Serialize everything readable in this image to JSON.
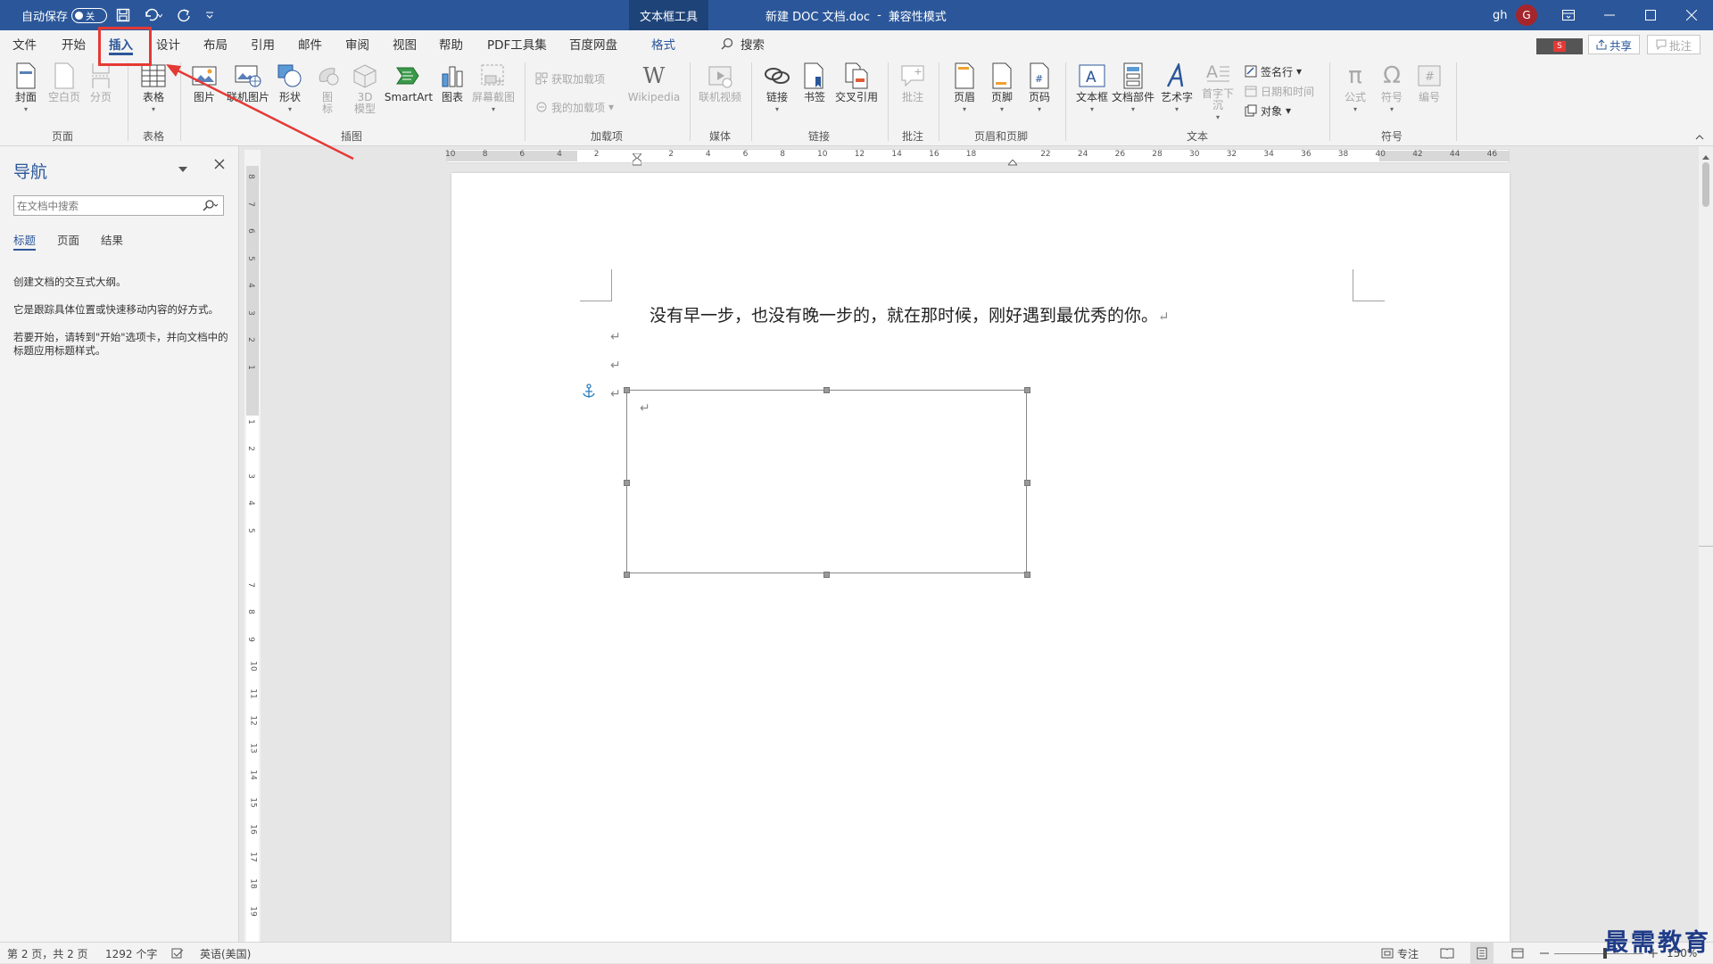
{
  "titlebar": {
    "autosave_label": "自动保存",
    "autosave_state": "关",
    "context_tab": "文本框工具",
    "doc_title": "新建 DOC 文档.doc",
    "separator": "-",
    "mode": "兼容性模式",
    "user": "gh",
    "avatar_letter": "G"
  },
  "tabs": [
    "文件",
    "开始",
    "插入",
    "设计",
    "布局",
    "引用",
    "邮件",
    "审阅",
    "视图",
    "帮助",
    "PDF工具集",
    "百度网盘",
    "格式"
  ],
  "search_label": "搜索",
  "share_label": "共享",
  "comment_label": "批注",
  "ribbon": {
    "cover": "封面",
    "blank": "空白页",
    "break": "分页",
    "table": "表格",
    "picture": "图片",
    "online_picture": "联机图片",
    "shapes": "形状",
    "icons_line1": "图",
    "icons_line2": "标",
    "model_line1": "3D",
    "model_line2": "模型",
    "smartart": "SmartArt",
    "chart": "图表",
    "screenshot": "屏幕截图",
    "get_addins": "获取加载项",
    "my_addins": "我的加载项",
    "wikipedia": "Wikipedia",
    "online_video": "联机视频",
    "link": "链接",
    "bookmark": "书签",
    "cross_ref": "交叉引用",
    "comment": "批注",
    "header": "页眉",
    "footer": "页脚",
    "page_number": "页码",
    "textbox": "文本框",
    "quick_parts": "文档部件",
    "wordart": "艺术字",
    "dropcap": "首字下沉",
    "signature": "签名行",
    "datetime": "日期和时间",
    "object": "对象",
    "equation": "公式",
    "symbol": "符号",
    "number": "编号"
  },
  "groups": [
    "页面",
    "表格",
    "插图",
    "加载项",
    "媒体",
    "链接",
    "批注",
    "页眉和页脚",
    "文本",
    "符号"
  ],
  "nav": {
    "title": "导航",
    "search_placeholder": "在文档中搜索",
    "tabs": [
      "标题",
      "页面",
      "结果"
    ],
    "msg1": "创建文档的交互式大纲。",
    "msg2": "它是跟踪具体位置或快速移动内容的好方式。",
    "msg3": "若要开始，请转到\"开始\"选项卡，并向文档中的标题应用标题样式。"
  },
  "ruler_numbers": [
    "10",
    "8",
    "6",
    "4",
    "2",
    "",
    "2",
    "4",
    "6",
    "8",
    "10",
    "12",
    "14",
    "16",
    "18",
    "",
    "22",
    "24",
    "26",
    "28",
    "30",
    "32",
    "34",
    "36",
    "38",
    "40",
    "42",
    "44",
    "46"
  ],
  "vruler_numbers": [
    "8",
    "7",
    "6",
    "5",
    "4",
    "3",
    "2",
    "1",
    "",
    "1",
    "2",
    "3",
    "4",
    "5",
    "",
    "7",
    "8",
    "9",
    "10",
    "11",
    "12",
    "13",
    "14",
    "15",
    "16",
    "17",
    "18",
    "19"
  ],
  "document": {
    "line1": "没有早一步，也没有晚一步的，就在那时候，刚好遇到最优秀的你。",
    "pilcrow": "↵"
  },
  "status": {
    "page": "第 2 页，共 2 页",
    "words": "1292 个字",
    "language": "英语(美国)",
    "focus": "专注",
    "zoom": "150%"
  },
  "watermark": "最需教育",
  "colors": {
    "title_bar": "#2b579a",
    "annotation": "#e53935"
  }
}
